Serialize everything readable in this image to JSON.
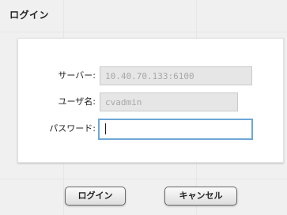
{
  "dialog": {
    "title": "ログイン"
  },
  "form": {
    "server": {
      "label": "サーバー:",
      "value": "10.40.70.133:6100"
    },
    "username": {
      "label": "ユーザ名:",
      "value": "cvadmin"
    },
    "password": {
      "label": "パスワード:",
      "value": ""
    }
  },
  "buttons": {
    "login_label": "ログイン",
    "cancel_label": "キャンセル"
  }
}
